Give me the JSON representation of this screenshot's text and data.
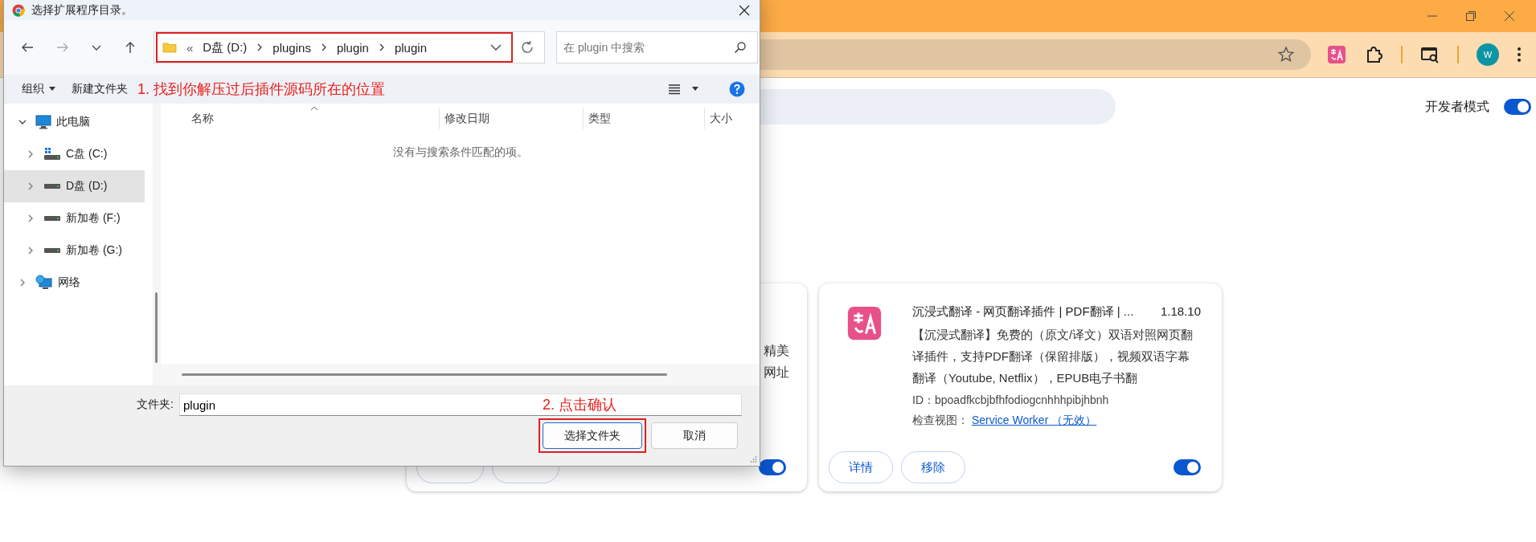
{
  "browser": {
    "toolbar": {
      "avatar_initial": "W"
    },
    "page": {
      "developer_mode": {
        "label": "开发者模式",
        "on": true
      },
      "extensions": [
        {
          "description_lines": [
            "精美",
            "网址"
          ],
          "enabled": true
        },
        {
          "title": "沉浸式翻译 - 网页翻译插件 | PDF翻译 | ...",
          "version": "1.18.10",
          "description": "【沉浸式翻译】免费的（原文/译文）双语对照网页翻译插件，支持PDF翻译（保留排版），视频双语字幕翻译（Youtube, Netflix），EPUB电子书翻",
          "id": "ID：bpoadfkcbjbfhfodiogcnhhhpibjhbnh",
          "inspect_label": "检查视图：",
          "inspect_link": "Service Worker （无效）",
          "buttons": [
            "详情",
            "移除"
          ],
          "enabled": true
        }
      ]
    }
  },
  "dialog": {
    "title": "选择扩展程序目录。",
    "address": {
      "overflow": "«",
      "path": [
        "D盘 (D:)",
        "plugins",
        "plugin",
        "plugin"
      ],
      "highlighted": true
    },
    "search": {
      "placeholder": "在 plugin 中搜索"
    },
    "toolbar": {
      "organize": "组织",
      "new_folder": "新建文件夹",
      "annotation": "1. 找到你解压过后插件源码所在的位置"
    },
    "nav_tree": [
      {
        "label": "此电脑",
        "kind": "computer",
        "expanded": true,
        "selected": false,
        "children": [
          {
            "label": "C盘 (C:)",
            "kind": "system-drive",
            "expanded": false,
            "selected": false
          },
          {
            "label": "D盘 (D:)",
            "kind": "drive",
            "expanded": false,
            "selected": true
          },
          {
            "label": "新加卷 (F:)",
            "kind": "drive",
            "expanded": false,
            "selected": false
          },
          {
            "label": "新加卷 (G:)",
            "kind": "drive",
            "expanded": false,
            "selected": false
          }
        ]
      },
      {
        "label": "网络",
        "kind": "network",
        "expanded": false,
        "selected": false
      }
    ],
    "columns": [
      "名称",
      "修改日期",
      "类型",
      "大小"
    ],
    "empty_message": "没有与搜索条件匹配的项。",
    "folder_field": {
      "label": "文件夹:",
      "value": "plugin",
      "annotation": "2. 点击确认"
    },
    "buttons": [
      {
        "label": "选择文件夹",
        "kind": "primary",
        "highlighted": true
      },
      {
        "label": "取消",
        "kind": "secondary",
        "highlighted": false
      }
    ]
  }
}
